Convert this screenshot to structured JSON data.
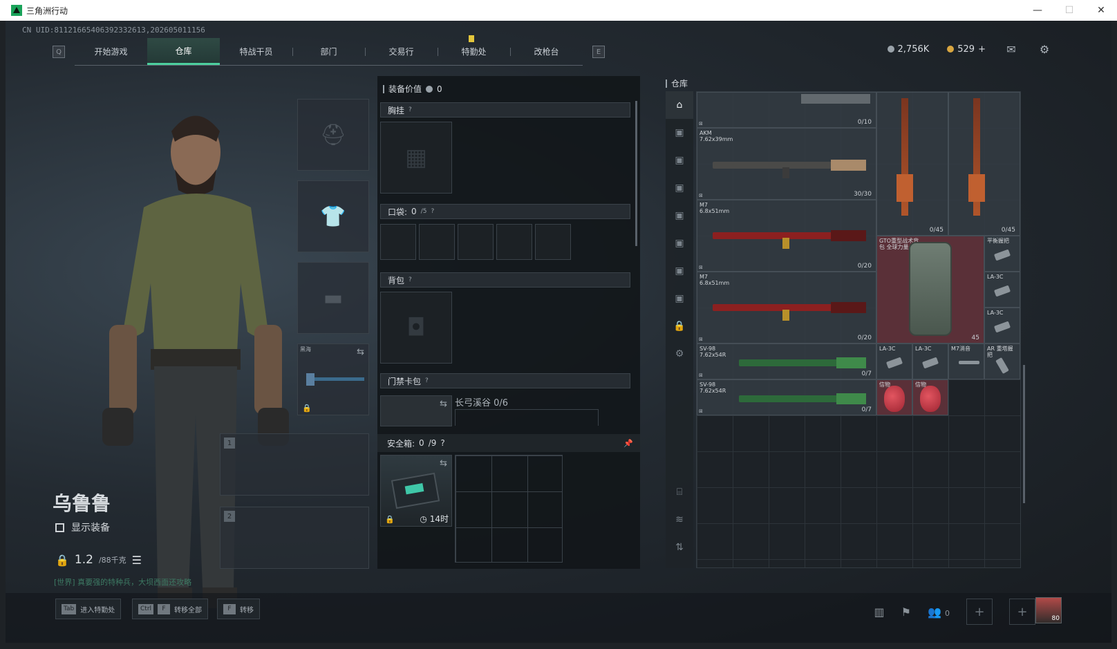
{
  "window": {
    "title": "三角洲行动",
    "controls": [
      "—",
      "☐",
      "✕"
    ]
  },
  "uid": "CN UID:81121665406392332613,202605011156",
  "nav": {
    "left_key": "Q",
    "right_key": "E",
    "tabs": [
      "开始游戏",
      "仓库",
      "特战干员",
      "部门",
      "交易行",
      "特勤处",
      "改枪台"
    ],
    "active": "仓库"
  },
  "currency": {
    "silver": "2,756K",
    "gold": "529",
    "gold_add": "+"
  },
  "character": {
    "name": "乌鲁鲁",
    "show_equipment_label": "显示装备",
    "capacity_value": "1.2",
    "capacity_max": "/88千克",
    "chat": "[世界] 真要强的特种兵，大坝西面还攻略"
  },
  "equipment": {
    "melee_label": "黑海",
    "weapon_slot_1": "1",
    "weapon_slot_2": "2"
  },
  "gear": {
    "value_label": "装备价值",
    "value": "0",
    "chest_label": "胸挂",
    "pockets_label": "口袋:",
    "pockets_count": "0",
    "pockets_max": "/5",
    "backpack_label": "背包",
    "keycard_label": "门禁卡包",
    "keycard_text": "长弓溪谷 0/6",
    "safe_label": "安全箱:",
    "safe_count": "0",
    "safe_max": "/9",
    "safe_time": "14时",
    "help_mark": "?"
  },
  "warehouse": {
    "title": "仓库",
    "items": {
      "top_rifle_count": "0/10",
      "akm_name": "AKM",
      "akm_caliber": "7.62x39mm",
      "akm_count": "30/30",
      "m7a_name": "M7",
      "m7a_caliber": "6.8x51mm",
      "m7a_count": "0/20",
      "m7b_name": "M7",
      "m7b_caliber": "6.8x51mm",
      "m7b_count": "0/20",
      "v1_count": "0/45",
      "v2_count": "0/45",
      "pack_name": "GTO重型战术背包 全球力量",
      "pack_count": "45",
      "grip_name": "平衡握把",
      "la3c_1": "LA-3C",
      "la3c_2": "LA-3C",
      "la3c_3": "LA-3C",
      "la3c_4": "LA-3C",
      "m7_suppressor": "M7消音",
      "ar_grip": "AR 重塔握把",
      "sv98a_name": "SV-98",
      "sv98a_caliber": "7.62x54R",
      "sv98a_count": "0/7",
      "sv98b_name": "SV-98",
      "sv98b_caliber": "7.62x54R",
      "sv98b_count": "0/7",
      "mask1": "信物",
      "mask2": "信物"
    }
  },
  "bottom": {
    "hint1_key": "Tab",
    "hint1": "进入特勤处",
    "hint2_key1": "Ctrl",
    "hint2_key2": "F",
    "hint2": "转移全部",
    "hint3_key": "F",
    "hint3": "转移",
    "friends_count": "0",
    "avatar_level": "80"
  },
  "colors": {
    "accent": "#4ccf9e",
    "pack_bg": "#5a3038",
    "notice": "#e3c63b"
  }
}
